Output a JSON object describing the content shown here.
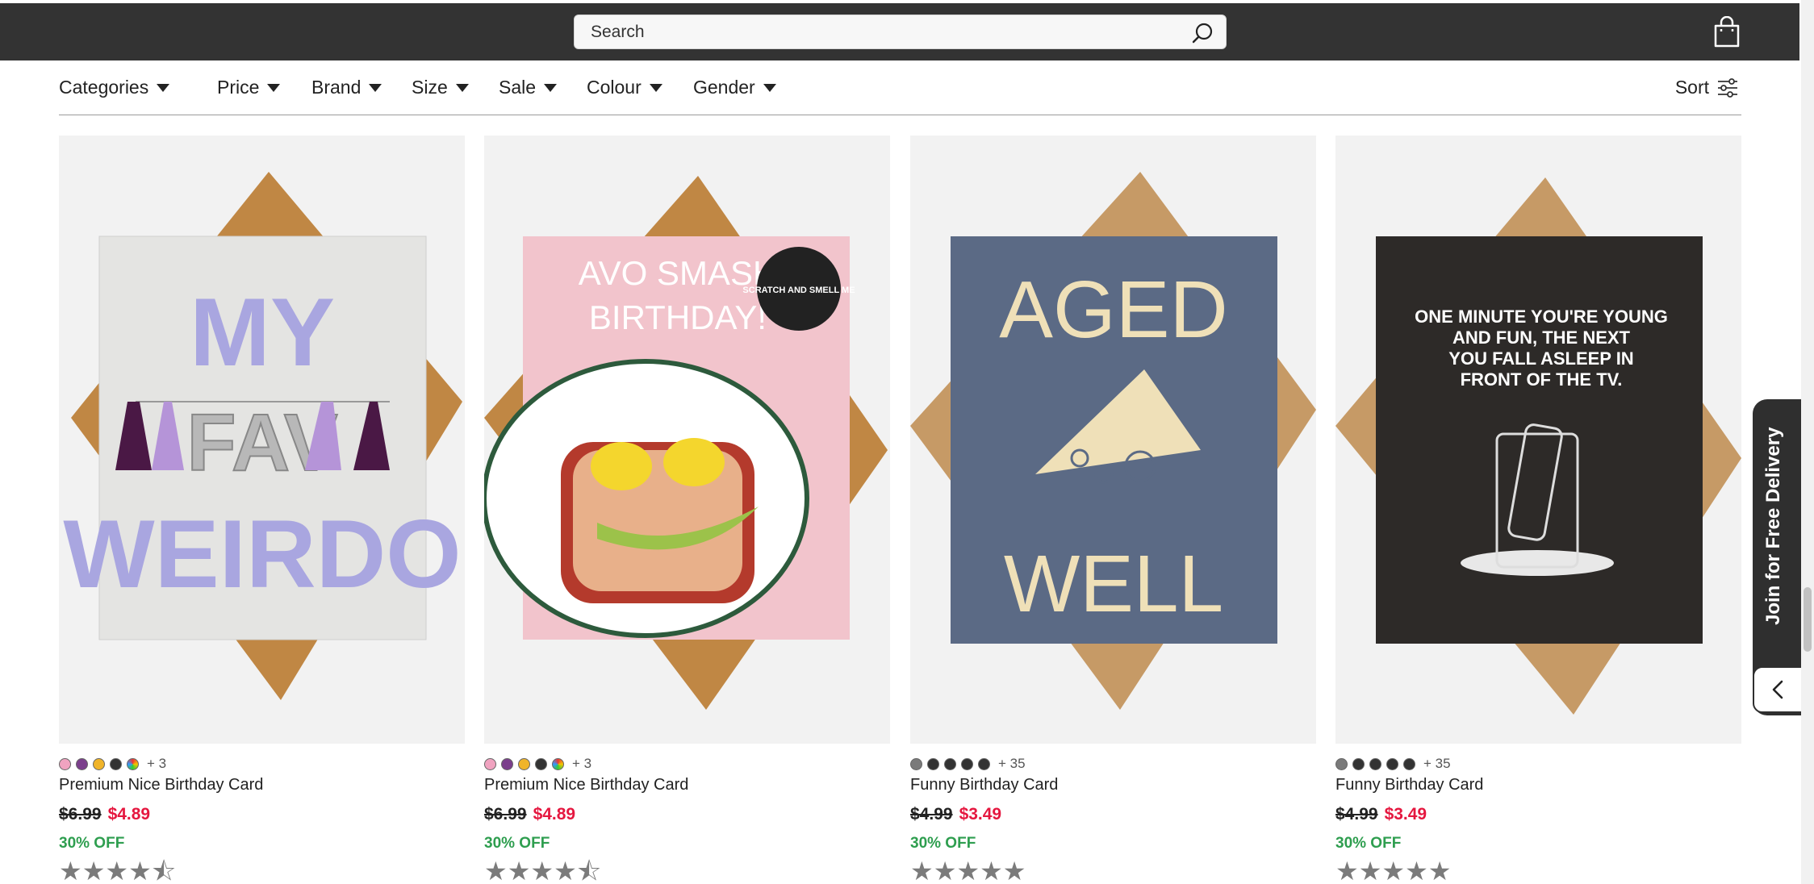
{
  "header": {
    "search_placeholder": "Search",
    "icons": [
      "search-icon",
      "shopping-bag-icon"
    ]
  },
  "filters": [
    {
      "label": "Categories"
    },
    {
      "label": "Price"
    },
    {
      "label": "Brand"
    },
    {
      "label": "Size"
    },
    {
      "label": "Sale"
    },
    {
      "label": "Colour"
    },
    {
      "label": "Gender"
    }
  ],
  "sort": {
    "label": "Sort",
    "icon": "sliders-icon"
  },
  "products": [
    {
      "name": "Premium Nice Birthday Card",
      "card_text": [
        "MY",
        "FAV",
        "WEIRDO"
      ],
      "swatches": [
        "#f0a3c0",
        "#7b3f8c",
        "#f0b429",
        "#333333",
        "rainbow"
      ],
      "more_colours": "+ 3",
      "old_price": "$6.99",
      "new_price": "$4.89",
      "discount": "30% OFF",
      "stars": "★★★★⯪"
    },
    {
      "name": "Premium Nice Birthday Card",
      "card_text": [
        "AVO SMASH",
        "BIRTHDAY!",
        "SCRATCH AND SMELL ME"
      ],
      "swatches": [
        "#f0a3c0",
        "#7b3f8c",
        "#f0b429",
        "#333333",
        "rainbow"
      ],
      "more_colours": "+ 3",
      "old_price": "$6.99",
      "new_price": "$4.89",
      "discount": "30% OFF",
      "stars": "★★★★⯪"
    },
    {
      "name": "Funny Birthday Card",
      "card_text": [
        "AGED",
        "WELL"
      ],
      "swatches": [
        "#7a7a7a",
        "#333333",
        "#333333",
        "#333333",
        "#333333"
      ],
      "more_colours": "+ 35",
      "old_price": "$4.99",
      "new_price": "$3.49",
      "discount": "30% OFF",
      "stars": "★★★★★"
    },
    {
      "name": "Funny Birthday Card",
      "card_text": [
        "ONE MINUTE YOU'RE YOUNG",
        "AND FUN, THE NEXT",
        "YOU FALL ASLEEP IN",
        "FRONT OF THE TV."
      ],
      "swatches": [
        "#7a7a7a",
        "#333333",
        "#333333",
        "#333333",
        "#333333"
      ],
      "more_colours": "+ 35",
      "old_price": "$4.99",
      "new_price": "$3.49",
      "discount": "30% OFF",
      "stars": "★★★★★"
    }
  ],
  "side_tab": {
    "label": "Join for Free Delivery",
    "icon": "chevron-left-icon"
  },
  "colors": {
    "sale_red": "#e5173f",
    "discount_green": "#2e9e4f",
    "header_bg": "#333333"
  }
}
